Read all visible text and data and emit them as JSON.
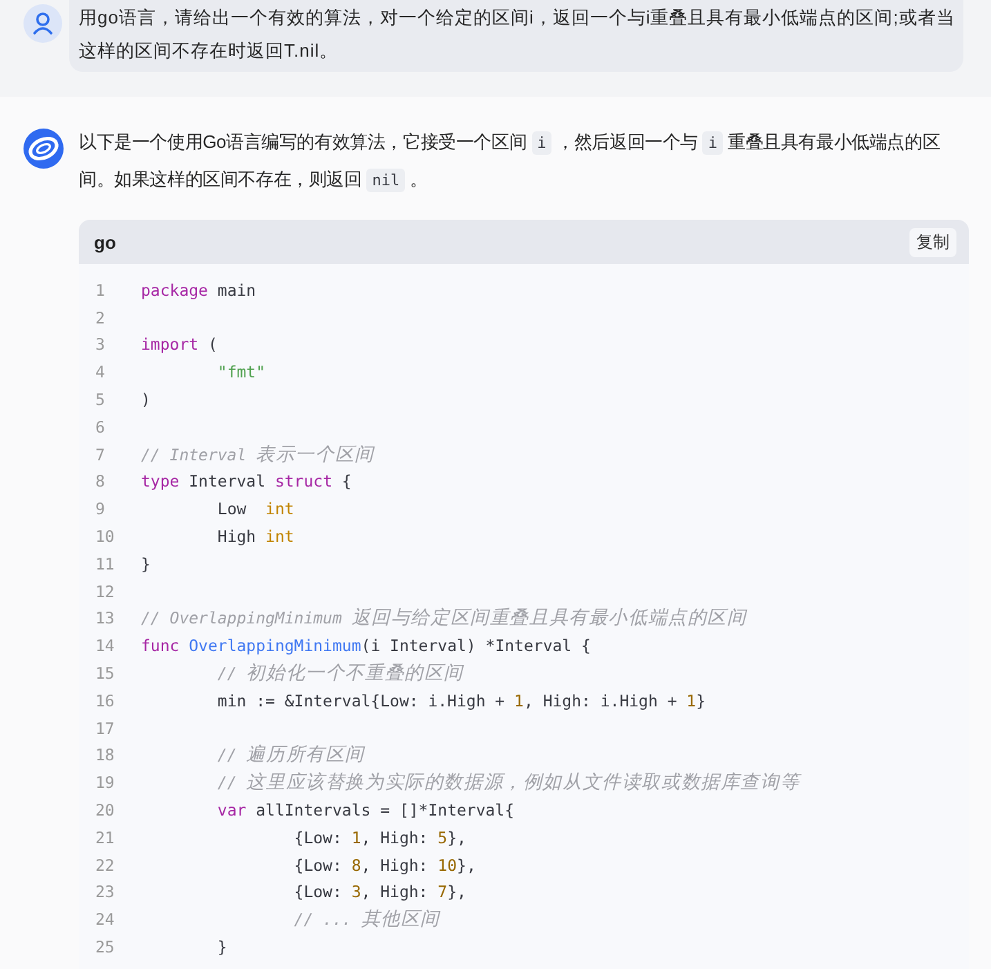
{
  "question": {
    "text": "用go语言，请给出一个有效的算法，对一个给定的区间i，返回一个与i重叠且具有最小低端点的区间;或者当这样的区间不存在时返回T.nil。"
  },
  "answer": {
    "paragraph": [
      {
        "kind": "text",
        "text": "以下是一个使用Go语言编写的有效算法，它接受一个区间 "
      },
      {
        "kind": "code",
        "text": "i"
      },
      {
        "kind": "text",
        "text": " ，然后返回一个与 "
      },
      {
        "kind": "code",
        "text": "i"
      },
      {
        "kind": "text",
        "text": " 重叠且具有最小低端点的区间。如果这样的区间不存在，则返回 "
      },
      {
        "kind": "code",
        "text": "nil"
      },
      {
        "kind": "text",
        "text": " 。"
      }
    ],
    "code_block": {
      "language": "go",
      "copy_button": "复制",
      "lines": [
        {
          "number": "1",
          "tokens": [
            {
              "kind": "keyword",
              "text": "package"
            },
            {
              "kind": "plain",
              "text": " main"
            }
          ]
        },
        {
          "number": "2"
        },
        {
          "number": "3",
          "tokens": [
            {
              "kind": "keyword",
              "text": "import"
            },
            {
              "kind": "plain",
              "text": " ("
            }
          ]
        },
        {
          "number": "4",
          "tokens": [
            {
              "kind": "string",
              "text": "\t\"fmt\""
            }
          ]
        },
        {
          "number": "5",
          "tokens": [
            {
              "kind": "plain",
              "text": ")"
            }
          ]
        },
        {
          "number": "6"
        },
        {
          "number": "7",
          "tokens": [
            {
              "kind": "comment",
              "text": "// Interval 表示一个区间"
            }
          ]
        },
        {
          "number": "8",
          "tokens": [
            {
              "kind": "keyword",
              "text": "type"
            },
            {
              "kind": "plain",
              "text": " Interval "
            },
            {
              "kind": "keyword",
              "text": "struct"
            },
            {
              "kind": "plain",
              "text": " {"
            }
          ]
        },
        {
          "number": "9",
          "tokens": [
            {
              "kind": "plain",
              "text": "\tLow  "
            },
            {
              "kind": "type",
              "text": "int"
            }
          ]
        },
        {
          "number": "10",
          "tokens": [
            {
              "kind": "plain",
              "text": "\tHigh "
            },
            {
              "kind": "type",
              "text": "int"
            }
          ]
        },
        {
          "number": "11",
          "tokens": [
            {
              "kind": "plain",
              "text": "}"
            }
          ]
        },
        {
          "number": "12"
        },
        {
          "number": "13",
          "tokens": [
            {
              "kind": "comment",
              "text": "// OverlappingMinimum 返回与给定区间重叠且具有最小低端点的区间"
            }
          ]
        },
        {
          "number": "14",
          "tokens": [
            {
              "kind": "keyword",
              "text": "func"
            },
            {
              "kind": "func",
              "text": " OverlappingMinimum"
            },
            {
              "kind": "plain",
              "text": "(i Interval) *Interval {"
            }
          ]
        },
        {
          "number": "15",
          "tokens": [
            {
              "kind": "comment",
              "text": "\t// 初始化一个不重叠的区间"
            }
          ]
        },
        {
          "number": "16",
          "tokens": [
            {
              "kind": "plain",
              "text": "\tmin := &Interval{Low: i.High + "
            },
            {
              "kind": "number",
              "text": "1"
            },
            {
              "kind": "plain",
              "text": ", High: i.High + "
            },
            {
              "kind": "number",
              "text": "1"
            },
            {
              "kind": "plain",
              "text": "}"
            }
          ]
        },
        {
          "number": "17"
        },
        {
          "number": "18",
          "tokens": [
            {
              "kind": "comment",
              "text": "\t// 遍历所有区间"
            }
          ]
        },
        {
          "number": "19",
          "tokens": [
            {
              "kind": "comment",
              "text": "\t// 这里应该替换为实际的数据源，例如从文件读取或数据库查询等"
            }
          ]
        },
        {
          "number": "20",
          "tokens": [
            {
              "kind": "keyword",
              "text": "\tvar"
            },
            {
              "kind": "plain",
              "text": " allIntervals = []*Interval{"
            }
          ]
        },
        {
          "number": "21",
          "tokens": [
            {
              "kind": "plain",
              "text": "\t\t{Low: "
            },
            {
              "kind": "number",
              "text": "1"
            },
            {
              "kind": "plain",
              "text": ", High: "
            },
            {
              "kind": "number",
              "text": "5"
            },
            {
              "kind": "plain",
              "text": "},"
            }
          ]
        },
        {
          "number": "22",
          "tokens": [
            {
              "kind": "plain",
              "text": "\t\t{Low: "
            },
            {
              "kind": "number",
              "text": "8"
            },
            {
              "kind": "plain",
              "text": ", High: "
            },
            {
              "kind": "number",
              "text": "10"
            },
            {
              "kind": "plain",
              "text": "},"
            }
          ]
        },
        {
          "number": "23",
          "tokens": [
            {
              "kind": "plain",
              "text": "\t\t{Low: "
            },
            {
              "kind": "number",
              "text": "3"
            },
            {
              "kind": "plain",
              "text": ", High: "
            },
            {
              "kind": "number",
              "text": "7"
            },
            {
              "kind": "plain",
              "text": "},"
            }
          ]
        },
        {
          "number": "24",
          "tokens": [
            {
              "kind": "comment",
              "text": "\t\t// ... 其他区间"
            }
          ]
        },
        {
          "number": "25",
          "tokens": [
            {
              "kind": "plain",
              "text": "\t}"
            }
          ]
        }
      ]
    }
  }
}
